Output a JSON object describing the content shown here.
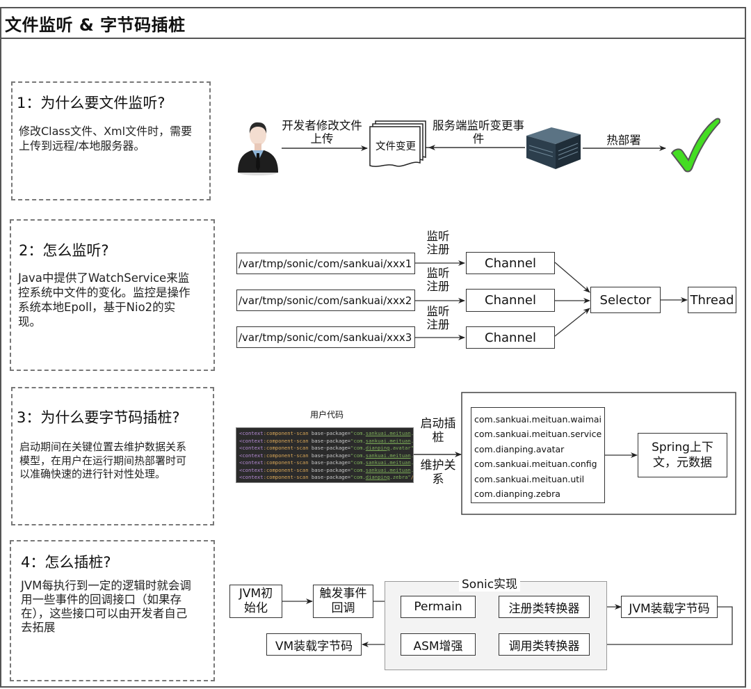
{
  "page": {
    "title": "文件监听 & 字节码插桩"
  },
  "sections": [
    {
      "title": "1：为什么要文件监听?",
      "text": "修改Class文件、Xml文件时，需要上传到远程/本地服务器。"
    },
    {
      "title": "2：怎么监听?",
      "text": "Java中提供了WatchService来监控系统中文件的变化。监控是操作系统本地Epoll，基于Nio2的实现。"
    },
    {
      "title": "3：为什么要字节码插桩?",
      "text": "启动期间在关键位置去维护数据关系模型，在用户在运行期间热部署时可以准确快速的进行针对性处理。"
    },
    {
      "title": "4：怎么插桩?",
      "text": "JVM每执行到一定的逻辑时就会调用一些事件的回调接口（如果存在），这些接口可以由开发者自己去拓展"
    }
  ],
  "flow1": {
    "developer_icon": "businessman-icon",
    "edge_modify_upload": "开发者修改文件上传",
    "document_label": "文件变更",
    "edge_server_listen": "服务端监听变更事件",
    "server_icon": "server-icon",
    "edge_hot_deploy": "热部署",
    "result_icon": "green-checkmark-icon",
    "colors": {
      "check": "#44dd22",
      "check_outline": "#555555"
    }
  },
  "flow2": {
    "paths": [
      "/var/tmp/sonic/com/sankuai/xxx1",
      "/var/tmp/sonic/com/sankuai/xxx2",
      "/var/tmp/sonic/com/sankuai/xxx3"
    ],
    "edge_label": "监听注册",
    "channel_label": "Channel",
    "selector_label": "Selector",
    "thread_label": "Thread"
  },
  "flow3": {
    "code_caption": "用户代码",
    "code_lines": [
      {
        "tag": "<context",
        "attr": ":component-scan",
        "plain": " base-package=",
        "str_prefix": "\"com.",
        "str_u": "sankuai.meituan",
        "str_suffix": ".waimai\"",
        "end": "/>"
      },
      {
        "tag": "<context",
        "attr": ":component-scan",
        "plain": " base-package=",
        "str_prefix": "\"com.",
        "str_u": "sankuai.meituan",
        "str_suffix": ".service\"",
        "end": "/>"
      },
      {
        "tag": "<context",
        "attr": ":component-scan",
        "plain": " base-package=",
        "str_prefix": "\"com.",
        "str_u": "dianping",
        "str_suffix": ".avatar\"",
        "end": "/>"
      },
      {
        "tag": "<context",
        "attr": ":component-scan",
        "plain": " base-package=",
        "str_prefix": "\"com.",
        "str_u": "sankuai.meituan",
        "str_suffix": ".config\"",
        "end": "/>"
      },
      {
        "tag": "<context",
        "attr": ":component-scan",
        "plain": " base-package=",
        "str_prefix": "\"com.",
        "str_u": "sankuai.meituan",
        "str_suffix": ".util\"",
        "end": "/>"
      },
      {
        "tag": "<context",
        "attr": ":component-scan",
        "plain": " base-package=",
        "str_prefix": "\"com.",
        "str_u": "sankuai.meituan",
        "str_suffix": ".common\"",
        "end": "/>"
      },
      {
        "tag": "<context",
        "attr": ":component-scan",
        "plain": " base-package=",
        "str_prefix": "\"com.",
        "str_u": "dianping",
        "str_suffix": ".zebra\"",
        "end": "/>"
      }
    ],
    "edge_label_top": "启动插桩",
    "edge_label_bottom": "维护关系",
    "packages": [
      "com.sankuai.meituan.waimai",
      "com.sankuai.meituan.service",
      "com.dianping.avatar",
      "com.sankuai.meituan.config",
      "com.sankuai.meituan.util",
      "com.dianping.zebra"
    ],
    "spring_label": "Spring上下文，元数据"
  },
  "flow4": {
    "jvm_init": "JVM初始化",
    "trigger_callback": "触发事件回调",
    "sonic_group_label": "Sonic实现",
    "permain": "Permain",
    "register_transformer": "注册类转换器",
    "jvm_load_bytecode": "JVM装载字节码",
    "invoke_transformer": "调用类转换器",
    "asm_enhance": "ASM增强",
    "vm_load_bytecode": "VM装载字节码"
  }
}
